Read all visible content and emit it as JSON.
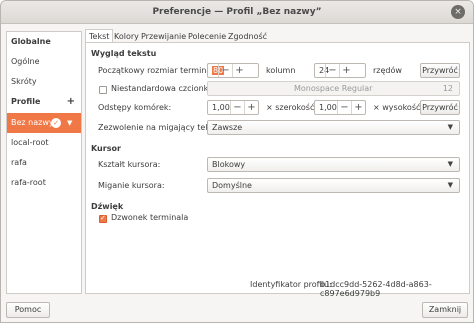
{
  "window": {
    "title": "Preferencje — Profil „Bez nazwy”"
  },
  "sidebar": {
    "global_header": "Globalne",
    "general": "Ogólne",
    "shortcuts": "Skróty",
    "profiles_header": "Profile",
    "profiles": [
      "Bez nazwy",
      "local-root",
      "rafa",
      "rafa-root"
    ]
  },
  "tabs": [
    "Tekst",
    "Kolory",
    "Przewijanie",
    "Polecenie",
    "Zgodność"
  ],
  "text_tab": {
    "appearance_header": "Wygląd tekstu",
    "initial_size_label": "Początkowy rozmiar terminala:",
    "columns_value": "80",
    "columns_unit": "kolumn",
    "rows_value": "24",
    "rows_unit": "rzędów",
    "restore_label": "Przywróć",
    "custom_font_label": "Niestandardowa czcionka:",
    "font_name": "Monospace Regular",
    "font_size": "12",
    "cell_spacing_label": "Odstępy komórek:",
    "spacing_width_value": "1,00",
    "spacing_width_unit": "× szerokość",
    "spacing_height_value": "1,00",
    "spacing_height_unit": "× wysokość",
    "blinking_label": "Zezwolenie na migający tekst:",
    "blinking_value": "Zawsze",
    "cursor_header": "Kursor",
    "cursor_shape_label": "Kształt kursora:",
    "cursor_shape_value": "Blokowy",
    "cursor_blink_label": "Miganie kursora:",
    "cursor_blink_value": "Domyślne",
    "sound_header": "Dźwięk",
    "bell_label": "Dzwonek terminala",
    "profile_id_label": "Identyfikator profilu:",
    "profile_id_value": "b1dcc9dd-5262-4d8d-a863-c897e6d979b9"
  },
  "footer": {
    "help_label": "Pomoc",
    "close_label": "Zamknij"
  },
  "spin": {
    "minus": "−",
    "plus": "+"
  },
  "icons": {
    "close": "close-icon",
    "check": "check-icon",
    "dropdown": "chevron-down-icon"
  },
  "colors": {
    "accent": "#f07746"
  }
}
